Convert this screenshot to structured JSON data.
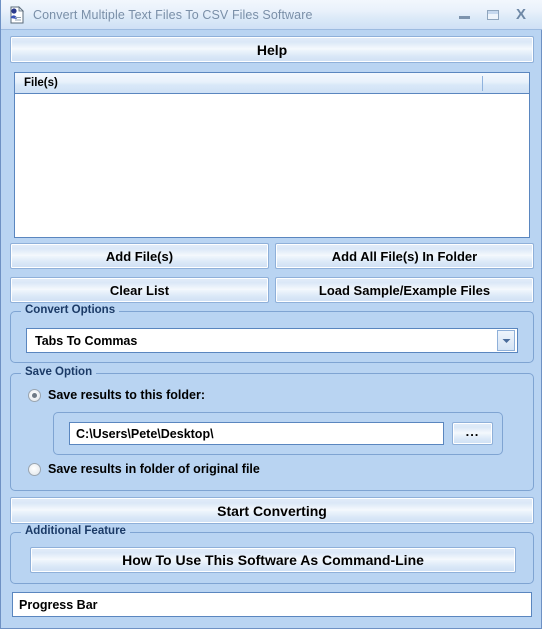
{
  "window": {
    "title": "Convert Multiple Text Files To CSV Files Software",
    "icon": "app-document-icon",
    "background_color": "#b9d4f2",
    "titlebar_controls": {
      "minimize": "minimize-icon",
      "maximize": "maximize-icon",
      "close": "X"
    }
  },
  "toolbar": {
    "help_label": "Help"
  },
  "file_list": {
    "columns": [
      "File(s)",
      ""
    ],
    "rows": []
  },
  "actions": {
    "add_files": "Add File(s)",
    "add_all_files_in_folder": "Add All File(s) In Folder",
    "clear_list": "Clear List",
    "load_sample_files": "Load Sample/Example Files"
  },
  "convert_options": {
    "group_title": "Convert Options",
    "selected": "Tabs To Commas",
    "dropdown_icon": "chevron-down-icon"
  },
  "save_option": {
    "group_title": "Save Option",
    "radio_folder_label": "Save results to this folder:",
    "radio_folder_selected": true,
    "folder_path": "C:\\Users\\Pete\\Desktop\\",
    "folder_path_placeholder": "",
    "browse_label": "...",
    "radio_original_label": "Save results in folder of original file",
    "radio_original_selected": false
  },
  "start": {
    "label": "Start Converting"
  },
  "additional_feature": {
    "group_title": "Additional Feature",
    "command_line_label": "How To Use This Software As Command-Line"
  },
  "progress": {
    "text": "Progress Bar"
  }
}
